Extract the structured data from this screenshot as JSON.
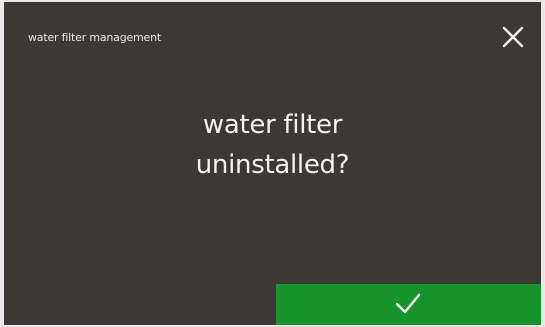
{
  "header": {
    "title": "water filter management",
    "close_icon": "close-icon"
  },
  "message": {
    "line1": "water filter",
    "line2": "uninstalled?"
  },
  "confirm": {
    "icon": "checkmark-icon",
    "color": "#15952b"
  },
  "colors": {
    "background": "#3c3935",
    "text": "#f2f2f2"
  }
}
